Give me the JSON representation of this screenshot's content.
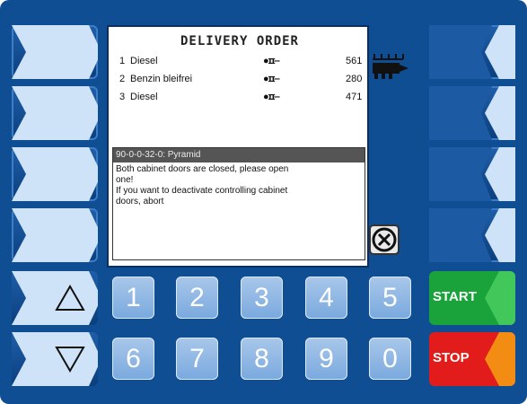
{
  "screen": {
    "title": "DELIVERY ORDER",
    "orders": [
      {
        "index": "1",
        "product": "Diesel",
        "symbol": "●ɪɪ‒",
        "value": "561"
      },
      {
        "index": "2",
        "product": "Benzin bleifrei",
        "symbol": "●ɪɪ‒",
        "value": "280"
      },
      {
        "index": "3",
        "product": "Diesel",
        "symbol": "●ɪɪ‒",
        "value": "471"
      }
    ],
    "message": {
      "header": "90-0-0-32-0: Pyramid",
      "lines": [
        "Both cabinet doors are closed, please open",
        "one!",
        "If you want to deactivate controlling cabinet",
        "doors, abort"
      ]
    }
  },
  "keypad": {
    "row1": [
      "1",
      "2",
      "3",
      "4",
      "5"
    ],
    "row2": [
      "6",
      "7",
      "8",
      "9",
      "0"
    ]
  },
  "commands": {
    "start": "START",
    "stop": "STOP"
  },
  "colors": {
    "frame": "#0f4e92",
    "softkey_arrow": "#cfe3f8",
    "start": "#19a33a",
    "stop": "#e21b1b",
    "stop_arrow": "#f28c13"
  }
}
